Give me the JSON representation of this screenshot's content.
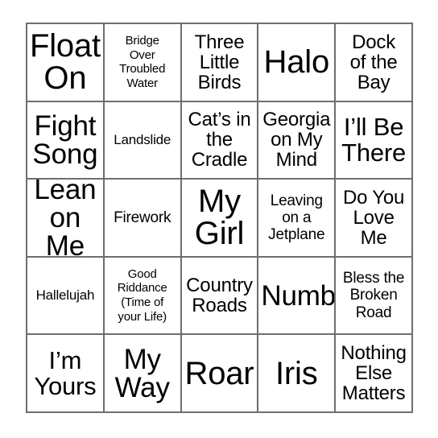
{
  "card": {
    "type": "bingo-card",
    "rows": 5,
    "columns": 5,
    "border_color": "#6e6e6e",
    "background_color": "#ffffff",
    "text_color": "#000000",
    "cells": [
      {
        "text": "Float\nOn",
        "size": "xxl"
      },
      {
        "text": "Bridge\nOver\nTroubled\nWater",
        "size": "xxs"
      },
      {
        "text": "Three\nLittle\nBirds",
        "size": "md"
      },
      {
        "text": "Halo",
        "size": "xxl"
      },
      {
        "text": "Dock\nof the\nBay",
        "size": "md"
      },
      {
        "text": "Fight\nSong",
        "size": "xl"
      },
      {
        "text": "Landslide",
        "size": "xs"
      },
      {
        "text": "Cat’s in\nthe\nCradle",
        "size": "md"
      },
      {
        "text": "Georgia\non My\nMind",
        "size": "md"
      },
      {
        "text": "I’ll Be\nThere",
        "size": "lg"
      },
      {
        "text": "Lean\non Me",
        "size": "xl"
      },
      {
        "text": "Firework",
        "size": "sm"
      },
      {
        "text": "My\nGirl",
        "size": "xxl"
      },
      {
        "text": "Leaving\non a\nJetplane",
        "size": "sm"
      },
      {
        "text": "Do You\nLove\nMe",
        "size": "md"
      },
      {
        "text": "Hallelujah",
        "size": "xs"
      },
      {
        "text": "Good\nRiddance\n(Time of\nyour Life)",
        "size": "xxs"
      },
      {
        "text": "Country\nRoads",
        "size": "md"
      },
      {
        "text": "Numb",
        "size": "xl"
      },
      {
        "text": "Bless the\nBroken\nRoad",
        "size": "sm"
      },
      {
        "text": "I’m\nYours",
        "size": "lg"
      },
      {
        "text": "My\nWay",
        "size": "xl"
      },
      {
        "text": "Roar",
        "size": "xxl"
      },
      {
        "text": "Iris",
        "size": "xxl"
      },
      {
        "text": "Nothing\nElse\nMatters",
        "size": "md"
      }
    ]
  }
}
